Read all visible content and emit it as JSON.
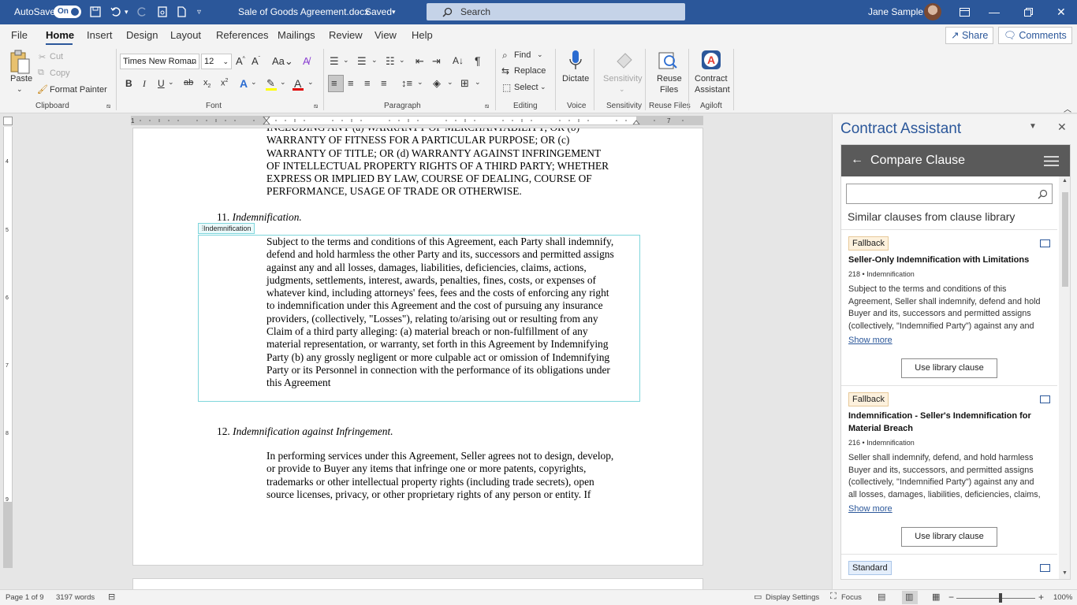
{
  "titlebar": {
    "autosave_label": "AutoSave",
    "autosave_state": "On",
    "doc_title": "Sale of Goods Agreement.docx",
    "save_status": "Saved",
    "search_placeholder": "Search",
    "user_name": "Jane Sample"
  },
  "tabs": [
    "File",
    "Home",
    "Insert",
    "Design",
    "Layout",
    "References",
    "Mailings",
    "Review",
    "View",
    "Help"
  ],
  "active_tab": "Home",
  "share_label": "Share",
  "comments_label": "Comments",
  "ribbon": {
    "clipboard": {
      "paste": "Paste",
      "cut": "Cut",
      "copy": "Copy",
      "format_painter": "Format Painter",
      "group": "Clipboard"
    },
    "font": {
      "name": "Times New Roman",
      "size": "12",
      "group": "Font"
    },
    "paragraph": {
      "group": "Paragraph"
    },
    "editing": {
      "find": "Find",
      "replace": "Replace",
      "select": "Select",
      "group": "Editing"
    },
    "voice": {
      "dictate": "Dictate",
      "group": "Voice"
    },
    "sensitivity": {
      "label": "Sensitivity",
      "group": "Sensitivity"
    },
    "reuse": {
      "label1": "Reuse",
      "label2": "Files",
      "group": "Reuse Files"
    },
    "agiloft": {
      "label1": "Contract",
      "label2": "Assistant",
      "group": "Agiloft"
    }
  },
  "document": {
    "top_paragraph": [
      "INCLUDING ANY (a) WARRANTY OF MERCHANTABILITY; OR (b)",
      "WARRANTY OF FITNESS FOR A PARTICULAR PURPOSE; OR (c)",
      "WARRANTY OF TITLE; OR (d) WARRANTY AGAINST INFRINGEMENT",
      "OF INTELLECTUAL PROPERTY RIGHTS OF A THIRD PARTY; WHETHER",
      "EXPRESS OR IMPLIED BY LAW, COURSE OF DEALING, COURSE OF",
      "PERFORMANCE, USAGE OF TRADE OR OTHERWISE."
    ],
    "section11_number": "11.",
    "section11_title": "Indemnification.",
    "content_control_tag": "Indemnification",
    "section11_body": [
      "Subject to the terms and conditions of this Agreement, each Party shall indemnify,",
      "defend and hold harmless the other Party and its, successors and permitted assigns",
      "against any and all losses, damages, liabilities, deficiencies, claims, actions,",
      "judgments, settlements, interest, awards, penalties, fines, costs, or expenses of",
      "whatever kind, including attorneys' fees, fees and the costs of enforcing any right",
      "to indemnification under this Agreement and the cost of pursuing any insurance",
      "providers, (collectively, \"Losses\"), relating to/arising out or resulting from any",
      "Claim of a third party alleging: (a) material breach or non-fulfillment of any",
      "material representation, or warranty, set forth in this Agreement by Indemnifying",
      "Party (b) any grossly negligent or more culpable act or omission of Indemnifying",
      "Party or its Personnel in connection with the performance of its obligations under",
      "this Agreement"
    ],
    "section12_number": "12.",
    "section12_title": "Indemnification against Infringement.",
    "section12_body": [
      "In performing services under this Agreement, Seller agrees not to design, develop,",
      "or provide to Buyer any items that infringe one or more patents, copyrights,",
      "trademarks or other intellectual property rights (including trade secrets), open",
      "source licenses, privacy, or other proprietary rights of any person or entity. If"
    ]
  },
  "panel": {
    "title": "Contract Assistant",
    "header": "Compare Clause",
    "subtitle": "Similar clauses from clause library",
    "cards": [
      {
        "badge": "Fallback",
        "title": "Seller-Only Indemnification with Limitations",
        "meta": "218 • Indemnification",
        "body": [
          "Subject to the terms and conditions of this",
          "Agreement, Seller shall indemnify, defend and hold",
          "Buyer and its, successors and permitted assigns",
          "(collectively, \"Indemnified Party\") against any and"
        ],
        "show_more": "Show more",
        "button": "Use library clause"
      },
      {
        "badge": "Fallback",
        "title": "Indemnification - Seller's Indemnification for Material Breach",
        "meta": "216 • Indemnification",
        "body": [
          "Seller shall indemnify, defend, and hold harmless",
          "Buyer and its, successors, and permitted assigns",
          "(collectively, \"Indemnified Party\") against any and",
          "all losses, damages, liabilities, deficiencies, claims,"
        ],
        "show_more": "Show more",
        "button": "Use library clause"
      },
      {
        "badge": "Standard"
      }
    ]
  },
  "status": {
    "page": "Page 1 of 9",
    "words": "3197 words",
    "display_settings": "Display Settings",
    "focus": "Focus",
    "zoom": "100%"
  }
}
